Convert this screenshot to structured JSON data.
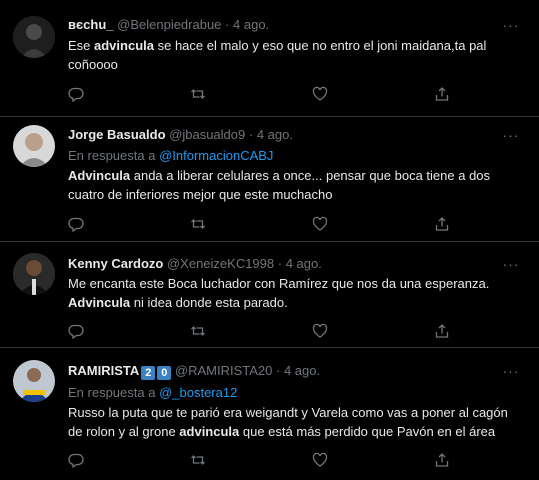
{
  "tweets": [
    {
      "name": "вєchu_",
      "handle": "@Belenpiedrabue",
      "date": "4 ago.",
      "reply_prefix": "",
      "reply_handle": "",
      "text_parts": [
        "Ese ",
        "advincula",
        " se hace el malo y eso que no entro el joni maidana,ta pal coñoooo"
      ],
      "avatar": "dark-photo"
    },
    {
      "name": "Jorge Basualdo",
      "handle": "@jbasualdo9",
      "date": "4 ago.",
      "reply_prefix": "En respuesta a",
      "reply_handle": "@InformacionCABJ",
      "text_parts": [
        "",
        "Advincula",
        " anda a liberar celulares a once... pensar que boca tiene a dos cuatro de inferiores mejor que este muchacho"
      ],
      "avatar": "light-photo"
    },
    {
      "name": "Kenny Cardozo",
      "handle": "@XeneizeKC1998",
      "date": "4 ago.",
      "reply_prefix": "",
      "reply_handle": "",
      "text_parts": [
        "Me encanta este Boca luchador con Ramírez que nos da una esperanza. ",
        "Advincula",
        " ni idea donde esta parado."
      ],
      "avatar": "dark-photo"
    },
    {
      "name": "RAMIRISTA",
      "badge_1": "2",
      "badge_2": "0",
      "handle": "@RAMIRISTA20",
      "date": "4 ago.",
      "reply_prefix": "En respuesta a",
      "reply_handle": "@_bostera12",
      "text_parts": [
        "Russo la puta que te parió era weigandt y Varela como vas a poner al cagón de rolon y al grone ",
        "advincula",
        " que está más perdido que Pavón en el área"
      ],
      "avatar": "jersey-photo"
    }
  ],
  "separator": "·",
  "icons": [
    "more-options-icon",
    "reply-icon",
    "retweet-icon",
    "like-icon",
    "share-icon"
  ],
  "colors": {
    "background": "#000000",
    "text": "#e7e9ea",
    "muted": "#71767b",
    "link": "#1d9bf0",
    "border": "#2f3336"
  }
}
